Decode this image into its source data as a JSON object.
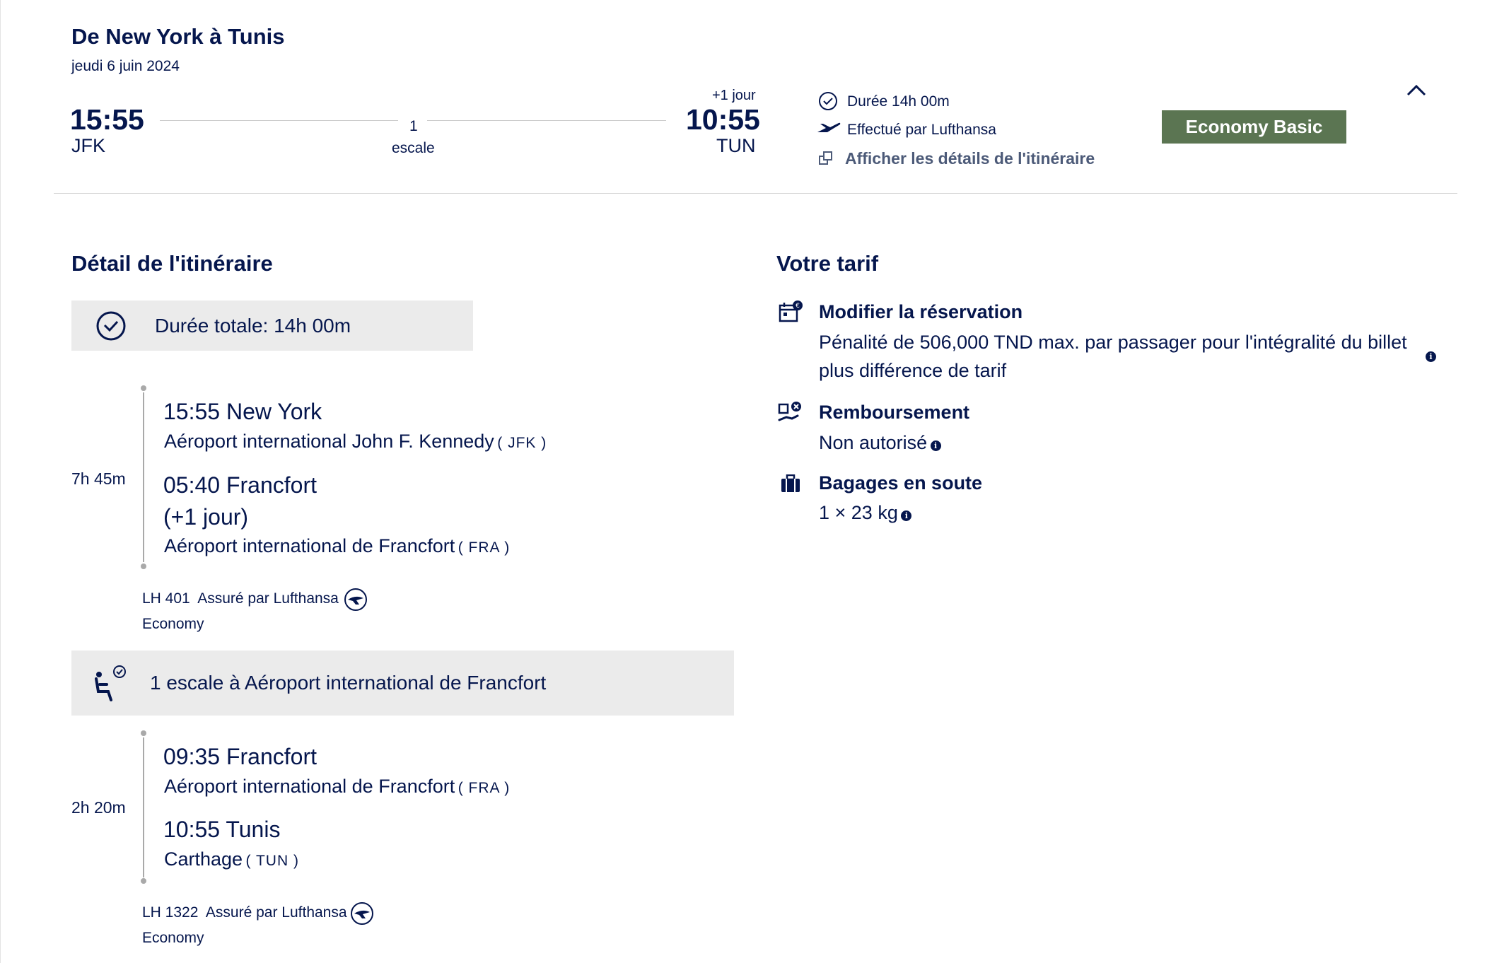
{
  "header": {
    "title": "De New York à Tunis",
    "date": "jeudi 6 juin 2024",
    "departure_time": "15:55",
    "departure_code": "JFK",
    "stops_count": "1",
    "stops_label": "escale",
    "day_offset": "+1 jour",
    "arrival_time": "10:55",
    "arrival_code": "TUN",
    "duration": "Durée 14h 00m",
    "operated_by": "Effectué par Lufthansa",
    "details_link": "Afficher les détails de l'itinéraire",
    "fare_button": "Economy Basic"
  },
  "itinerary": {
    "title": "Détail de l'itinéraire",
    "total_duration": "Durée totale: 14h 00m",
    "segment1": {
      "duration": "7h 45m",
      "dep_line": "15:55 New York",
      "dep_airport": "Aéroport international John F. Kennedy",
      "dep_code": "( JFK )",
      "arr_line": "05:40 Francfort",
      "arr_day": "(+1 jour)",
      "arr_airport": "Aéroport international de Francfort",
      "arr_code": "( FRA )",
      "flight": "LH 401",
      "operated": "Assuré par Lufthansa",
      "cabin": "Economy"
    },
    "layover": "1 escale à Aéroport international de Francfort",
    "segment2": {
      "duration": "2h 20m",
      "dep_line": "09:35 Francfort",
      "dep_airport": "Aéroport international de Francfort",
      "dep_code": "( FRA )",
      "arr_line": "10:55 Tunis",
      "arr_airport": "Carthage",
      "arr_code": "( TUN )",
      "flight": "LH 1322",
      "operated": "Assuré par Lufthansa",
      "cabin": "Economy"
    }
  },
  "fare": {
    "title": "Votre tarif",
    "change_label": "Modifier la réservation",
    "change_value_1": "Pénalité de 506,000 TND max. par passager pour l'intégralité du billet",
    "change_value_2": "plus différence de tarif",
    "refund_label": "Remboursement",
    "refund_value": "Non autorisé",
    "baggage_label": "Bagages en soute",
    "baggage_value": "1 × 23 kg"
  },
  "icons": {
    "clock": "clock-icon",
    "plane": "plane-icon",
    "external": "external-link-icon",
    "chevron": "chevron-up-icon",
    "lufthansa": "lufthansa-logo-icon",
    "layover": "seat-clock-icon",
    "calendar": "calendar-change-icon",
    "refund": "refund-icon",
    "baggage": "baggage-icon",
    "info": "info-icon"
  },
  "colors": {
    "text": "#05164d",
    "fare_button": "#5b7552",
    "panel": "#ebebeb",
    "link": "#4c5a78"
  }
}
